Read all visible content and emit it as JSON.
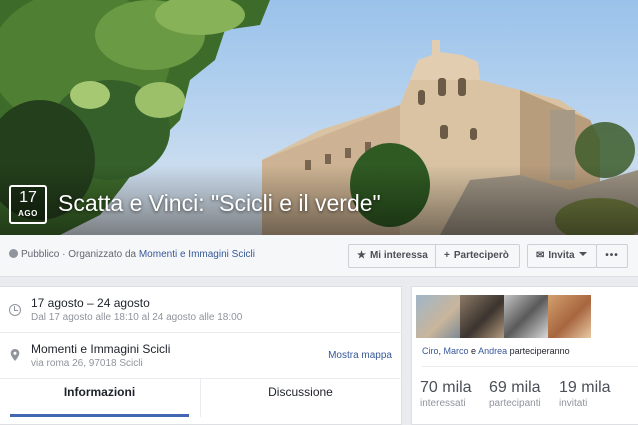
{
  "cover": {
    "date_day": "17",
    "date_month": "AGO",
    "title": "Scatta e Vinci: \"Scicli e il verde\""
  },
  "infobar": {
    "privacy": "Pubblico",
    "organized_prefix": " · Organizzato da ",
    "organizer": "Momenti e Immagini Scicli",
    "interest_label": "Mi interessa",
    "going_label": "Parteciperò",
    "invite_label": "Invita",
    "more_label": "•••"
  },
  "details": {
    "date_range": "17 agosto – 24 agosto",
    "date_detail": "Dal 17 agosto alle 18:10 al 24 agosto alle 18:00",
    "place_name": "Momenti e Immagini Scicli",
    "place_address": "via roma 26, 97018 Scicli",
    "map_link": "Mostra mappa"
  },
  "tabs": {
    "info": "Informazioni",
    "discussion": "Discussione"
  },
  "attendance": {
    "friend1": "Ciro",
    "sep1": ", ",
    "friend2": "Marco",
    "sep2": " e ",
    "friend3": "Andrea",
    "suffix": " parteciperanno",
    "stats": [
      {
        "num": "70 mila",
        "label": "interessati"
      },
      {
        "num": "69 mila",
        "label": "partecipanti"
      },
      {
        "num": "19 mila",
        "label": "invitati"
      }
    ]
  },
  "colors": {
    "link": "#365899",
    "accent": "#4267b2",
    "muted": "#90949c"
  },
  "icons": {
    "privacy": "globe-icon",
    "interest": "star-icon",
    "going": "plus-icon",
    "invite": "envelope-icon",
    "time": "clock-icon",
    "place": "pin-icon"
  }
}
